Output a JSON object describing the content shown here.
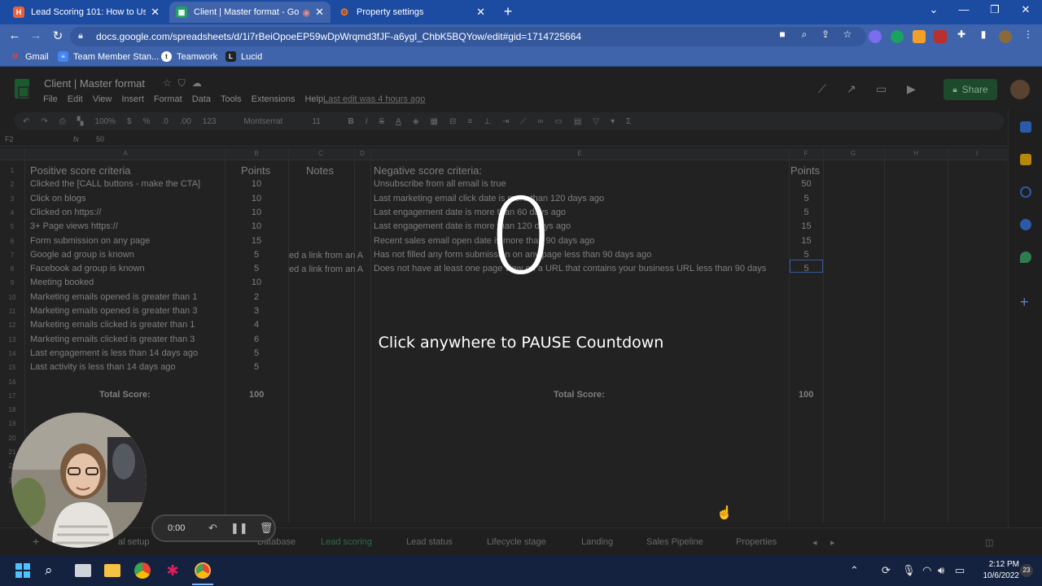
{
  "browser": {
    "tabs": [
      {
        "title": "Lead Scoring 101: How to Use Da",
        "favicon_color": "#e8613c",
        "active": false
      },
      {
        "title": "Client | Master format - Goo",
        "favicon_color": "#1ea362",
        "active": true
      },
      {
        "title": "Property settings",
        "favicon_color": "#f57722",
        "active": false
      }
    ],
    "url": "docs.google.com/spreadsheets/d/1i7rBeiOpoeEP59wDpWrqmd3fJF-a6ygl_ChbK5BQYow/edit#gid=1714725664",
    "bookmarks": [
      {
        "label": "Gmail",
        "icon": "gmail-icon"
      },
      {
        "label": "Team Member Stan...",
        "icon": "docs-icon"
      },
      {
        "label": "Teamwork",
        "icon": "teamwork-icon"
      },
      {
        "label": "Lucid",
        "icon": "lucid-icon"
      }
    ]
  },
  "sheets": {
    "title": "Client | Master format",
    "menu": [
      "File",
      "Edit",
      "View",
      "Insert",
      "Format",
      "Data",
      "Tools",
      "Extensions",
      "Help"
    ],
    "last_edit": "Last edit was 4 hours ago",
    "share_label": "Share",
    "toolbar": {
      "zoom": "100%",
      "currency": "$",
      "percent": "%",
      "dec_less": ".0",
      "dec_more": ".00",
      "format": "123",
      "font": "Montserrat",
      "font_size": "11"
    },
    "name_box": "F2",
    "formula_value": "50",
    "columns": [
      "A",
      "B",
      "C",
      "D",
      "E",
      "F",
      "G",
      "H",
      "I"
    ],
    "rows": [
      "1",
      "2",
      "3",
      "4",
      "5",
      "6",
      "7",
      "8",
      "9",
      "10",
      "11",
      "12",
      "13",
      "14",
      "15",
      "16",
      "17",
      "18",
      "19",
      "20",
      "21",
      "22",
      "23"
    ],
    "positive": {
      "header": "Positive score criteria",
      "points_header": "Points",
      "notes_header": "Notes",
      "rows": [
        {
          "label": "Clicked the [CALL buttons - make the CTA]",
          "points": "10"
        },
        {
          "label": "Click on blogs",
          "points": "10"
        },
        {
          "label": "Clicked on https://",
          "points": "10"
        },
        {
          "label": "3+ Page views https://",
          "points": "10"
        },
        {
          "label": "Form submission on any page",
          "points": "15"
        },
        {
          "label": "Google ad group is known",
          "points": "5"
        },
        {
          "label": "Facebook ad group is known",
          "points": "5"
        },
        {
          "label": "Meeting booked",
          "points": "10"
        },
        {
          "label": "Marketing emails opened is greater than 1",
          "points": "2"
        },
        {
          "label": "Marketing emails opened is greater than 3",
          "points": "3"
        },
        {
          "label": "Marketing emails clicked is greater than 1",
          "points": "4"
        },
        {
          "label": "Marketing emails clicked is greater than 3",
          "points": "6"
        },
        {
          "label": "Last engagement is less than 14 days ago",
          "points": "5"
        },
        {
          "label": "Last activity is less than 14 days ago",
          "points": "5"
        }
      ],
      "notes": [
        "ed a link from an A",
        "ed a link from an A"
      ],
      "total_label": "Total Score:",
      "total_value": "100"
    },
    "negative": {
      "header": "Negative score criteria:",
      "points_header": "Points",
      "rows": [
        {
          "label": "Unsubscribe from all email is true",
          "points": "50"
        },
        {
          "label": "Last marketing email click date is more than 120 days ago",
          "points": "5"
        },
        {
          "label": "Last engagement date is more than 60 days ago",
          "points": "5"
        },
        {
          "label": "Last engagement date is more than 120 days ago",
          "points": "15"
        },
        {
          "label": "Recent sales email open date is more than 90 days ago",
          "points": "15"
        },
        {
          "label": "Has not filled any form submission on any page less than 90 days ago",
          "points": "5"
        },
        {
          "label": "Does not have at least one page view on a URL that contains your business URL less than 90 days",
          "points": "5"
        }
      ],
      "total_label": "Total Score:",
      "total_value": "100"
    },
    "sheet_tabs": [
      "al setup",
      "Database",
      "Lead scoring",
      "Lead status",
      "Lifecycle stage",
      "Landing",
      "Sales Pipeline",
      "Properties"
    ],
    "active_sheet": "Lead scoring"
  },
  "overlay": {
    "countdown": "0",
    "message": "Click anywhere to PAUSE Countdown",
    "recorder_time": "0:00"
  },
  "taskbar": {
    "time": "2:12 PM",
    "date": "10/6/2022",
    "notifications": "23"
  }
}
